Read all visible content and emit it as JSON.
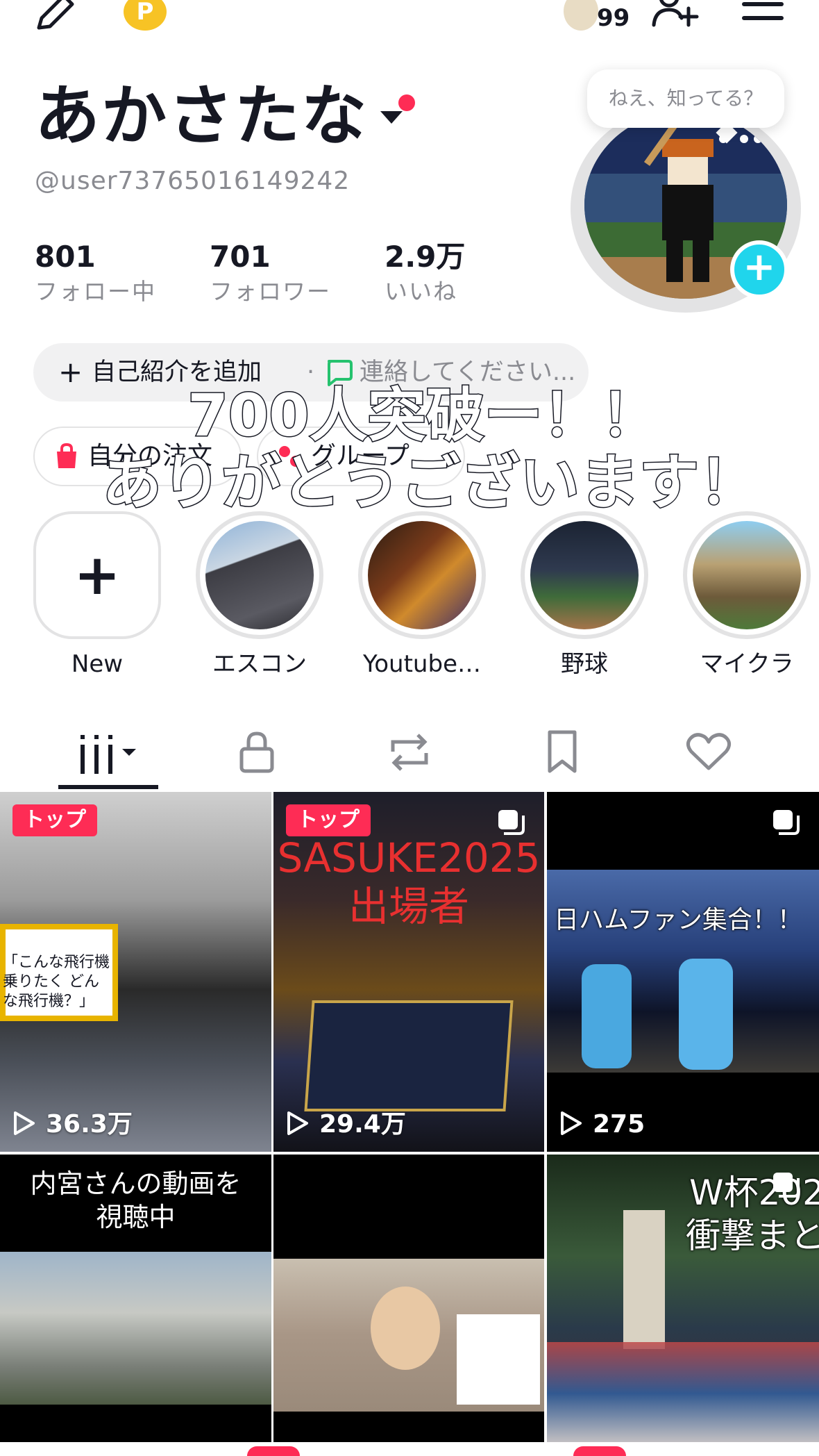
{
  "top_bar": {
    "notification_count": "99",
    "coin_symbol": "P"
  },
  "profile": {
    "display_name": "あかさたな",
    "username": "@user73765016149242",
    "speech_bubble": "ねえ、知ってる？",
    "avatar_add_symbol": "+"
  },
  "stats": [
    {
      "value": "801",
      "label": "フォロー中"
    },
    {
      "value": "701",
      "label": "フォロワー"
    },
    {
      "value": "2.9万",
      "label": "いいね"
    }
  ],
  "bio": {
    "plus": "+",
    "add_bio_label": "自己紹介を追加",
    "separator": "·",
    "contact_label": "連絡してください..."
  },
  "quick_links": [
    {
      "label": "自分の注文"
    },
    {
      "label": "グループ"
    }
  ],
  "overlay": {
    "line1": "700人突破ー！！",
    "line2": "ありがとうございます！"
  },
  "highlights": [
    {
      "label": "New",
      "symbol": "+"
    },
    {
      "label": "エスコン"
    },
    {
      "label": "Youtube…"
    },
    {
      "label": "野球"
    },
    {
      "label": "マイクラ"
    }
  ],
  "videos": [
    {
      "badge": "トップ",
      "views": "36.3万",
      "caption": "「こんな飛行機乗りたく どんな飛行機？」"
    },
    {
      "badge": "トップ",
      "views": "29.4万",
      "caption": "SASUKE2025 出場者"
    },
    {
      "views": "275",
      "caption": "日ハムファン集合！！"
    },
    {
      "caption": "内宮さんの動画を 視聴中"
    },
    {
      "caption": ""
    },
    {
      "caption": "W杯202 衝撃まと"
    }
  ],
  "colors": {
    "accent": "#fe2c55",
    "avatar_add": "#20d5ec",
    "secondary_text": "#8a8b91",
    "pill_bg": "#f1f1f2"
  }
}
